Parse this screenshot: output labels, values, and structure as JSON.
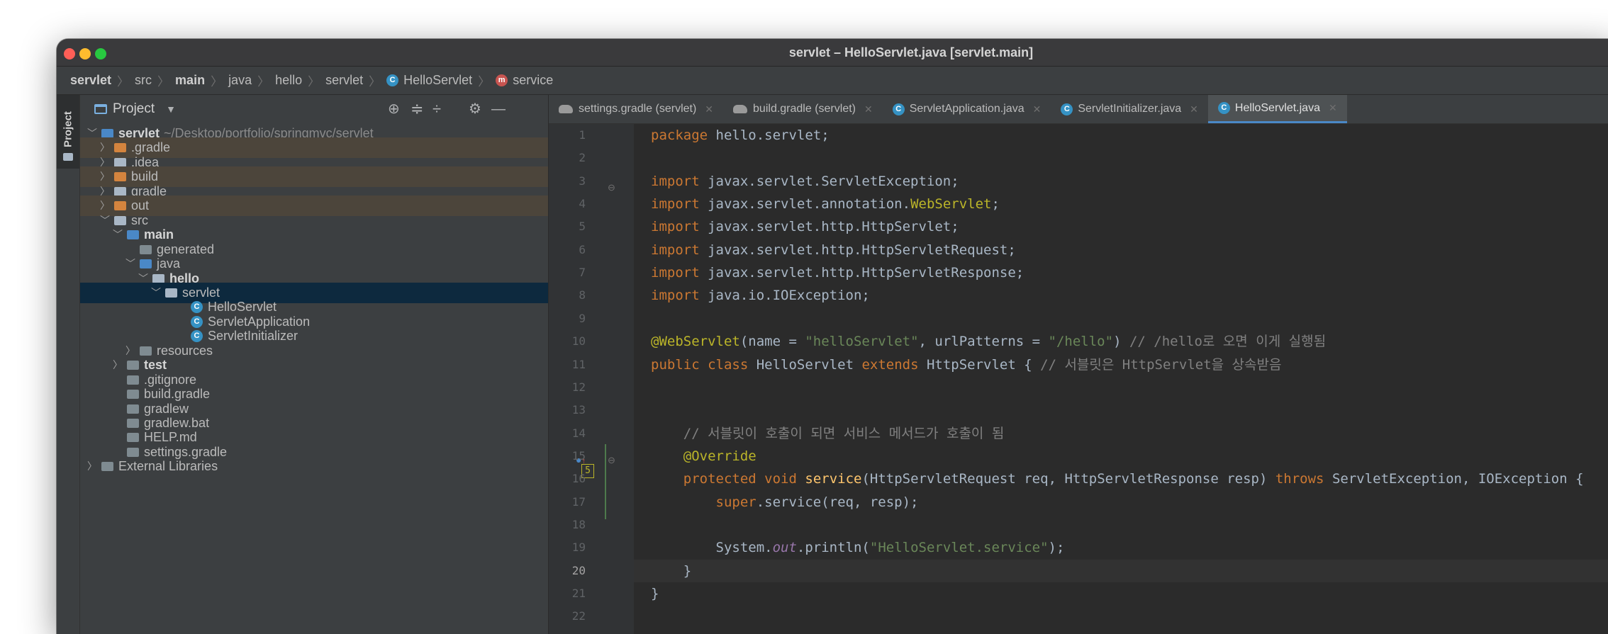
{
  "window": {
    "title": "servlet – HelloServlet.java [servlet.main]"
  },
  "colors": {
    "accent": "#4a88c7",
    "class_icon": "#3592c4",
    "method_icon": "#c75450",
    "excluded_folder": "#d4843e"
  },
  "breadcrumb": [
    {
      "label": "servlet",
      "bold": true,
      "icon": ""
    },
    {
      "label": "src",
      "bold": false,
      "icon": ""
    },
    {
      "label": "main",
      "bold": true,
      "icon": ""
    },
    {
      "label": "java",
      "bold": false,
      "icon": ""
    },
    {
      "label": "hello",
      "bold": false,
      "icon": ""
    },
    {
      "label": "servlet",
      "bold": false,
      "icon": ""
    },
    {
      "label": "HelloServlet",
      "bold": false,
      "icon": "class-icon"
    },
    {
      "label": "service",
      "bold": false,
      "icon": "method-icon"
    }
  ],
  "side_strip": {
    "label": "Project"
  },
  "project_panel": {
    "title": "Project",
    "tree": [
      {
        "label": "servlet",
        "detail": "~/Desktop/portfolio/springmvc/servlet",
        "depth": 0,
        "chevron": "open",
        "icon": "module",
        "bold": true,
        "style": ""
      },
      {
        "label": ".gradle",
        "depth": 1,
        "chevron": "closed",
        "icon": "folder-excluded",
        "bold": false,
        "style": "ignored"
      },
      {
        "label": ".idea",
        "depth": 1,
        "chevron": "closed",
        "icon": "folder",
        "bold": false,
        "style": ""
      },
      {
        "label": "build",
        "depth": 1,
        "chevron": "closed",
        "icon": "folder-excluded",
        "bold": false,
        "style": "ignored"
      },
      {
        "label": "gradle",
        "depth": 1,
        "chevron": "closed",
        "icon": "folder",
        "bold": false,
        "style": ""
      },
      {
        "label": "out",
        "depth": 1,
        "chevron": "closed",
        "icon": "folder-excluded",
        "bold": false,
        "style": "ignored"
      },
      {
        "label": "src",
        "depth": 1,
        "chevron": "open",
        "icon": "folder",
        "bold": false,
        "style": ""
      },
      {
        "label": "main",
        "depth": 2,
        "chevron": "open",
        "icon": "source-root",
        "bold": true,
        "style": ""
      },
      {
        "label": "generated",
        "depth": 3,
        "chevron": "",
        "icon": "generated-folder",
        "bold": false,
        "style": ""
      },
      {
        "label": "java",
        "depth": 3,
        "chevron": "open",
        "icon": "source-folder",
        "bold": false,
        "style": ""
      },
      {
        "label": "hello",
        "depth": 4,
        "chevron": "open",
        "icon": "package",
        "bold": true,
        "style": ""
      },
      {
        "label": "servlet",
        "depth": 5,
        "chevron": "open",
        "icon": "package",
        "bold": false,
        "style": "selected"
      },
      {
        "label": "HelloServlet",
        "depth": 7,
        "chevron": "",
        "icon": "class",
        "bold": false,
        "style": ""
      },
      {
        "label": "ServletApplication",
        "depth": 7,
        "chevron": "",
        "icon": "class",
        "bold": false,
        "style": ""
      },
      {
        "label": "ServletInitializer",
        "depth": 7,
        "chevron": "",
        "icon": "class",
        "bold": false,
        "style": ""
      },
      {
        "label": "resources",
        "depth": 3,
        "chevron": "closed",
        "icon": "resources-folder",
        "bold": false,
        "style": ""
      },
      {
        "label": "test",
        "depth": 2,
        "chevron": "closed",
        "icon": "test-folder",
        "bold": true,
        "style": ""
      },
      {
        "label": ".gitignore",
        "depth": 2,
        "chevron": "",
        "icon": "file",
        "bold": false,
        "style": ""
      },
      {
        "label": "build.gradle",
        "depth": 2,
        "chevron": "",
        "icon": "gradle",
        "bold": false,
        "style": ""
      },
      {
        "label": "gradlew",
        "depth": 2,
        "chevron": "",
        "icon": "terminal-file",
        "bold": false,
        "style": ""
      },
      {
        "label": "gradlew.bat",
        "depth": 2,
        "chevron": "",
        "icon": "file",
        "bold": false,
        "style": ""
      },
      {
        "label": "HELP.md",
        "depth": 2,
        "chevron": "",
        "icon": "markdown-file",
        "bold": false,
        "style": ""
      },
      {
        "label": "settings.gradle",
        "depth": 2,
        "chevron": "",
        "icon": "gradle",
        "bold": false,
        "style": ""
      },
      {
        "label": "External Libraries",
        "depth": 0,
        "chevron": "closed",
        "icon": "libraries",
        "bold": false,
        "style": ""
      }
    ]
  },
  "editor_tabs": [
    {
      "label": "settings.gradle (servlet)",
      "icon": "gradle-icon",
      "active": false
    },
    {
      "label": "build.gradle (servlet)",
      "icon": "gradle-icon",
      "active": false
    },
    {
      "label": "ServletApplication.java",
      "icon": "class-icon",
      "active": false
    },
    {
      "label": "ServletInitializer.java",
      "icon": "class-icon",
      "active": false
    },
    {
      "label": "HelloServlet.java",
      "icon": "class-icon",
      "active": true
    }
  ],
  "editor": {
    "current_line": 20,
    "line_numbers": [
      "1",
      "2",
      "3",
      "4",
      "5",
      "6",
      "7",
      "8",
      "9",
      "10",
      "11",
      "12",
      "13",
      "14",
      "15",
      "16",
      "17",
      "18",
      "19",
      "20",
      "21",
      "22"
    ],
    "code": [
      "package hello.servlet;",
      "",
      "import javax.servlet.ServletException;",
      "import javax.servlet.annotation.WebServlet;",
      "import javax.servlet.http.HttpServlet;",
      "import javax.servlet.http.HttpServletRequest;",
      "import javax.servlet.http.HttpServletResponse;",
      "import java.io.IOException;",
      "",
      "@WebServlet(name = \"helloServlet\", urlPatterns = \"/hello\") // /hello로 오면 이게 실행됨",
      "public class HelloServlet extends HttpServlet { // 서블릿은 HttpServlet을 상속받음",
      "",
      "",
      "    // 서블릿이 호출이 되면 서비스 메서드가 호출이 됨",
      "    @Override",
      "    protected void service(HttpServletRequest req, HttpServletResponse resp) throws ServletException, IOException {",
      "        super.service(req, resp);",
      "",
      "        System.out.println(\"HelloServlet.service\");",
      "    }",
      "}",
      ""
    ],
    "gutter_badge": "5"
  }
}
